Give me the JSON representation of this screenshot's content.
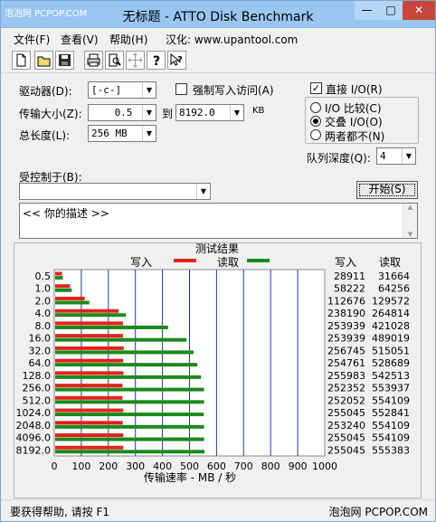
{
  "titlebar": {
    "watermark": "泡泡网 PCPOP.COM",
    "title": "无标题 - ATTO Disk Benchmark",
    "min": "—",
    "max": "□",
    "close": "✕"
  },
  "menu": {
    "file": "文件(F)",
    "view": "查看(V)",
    "help": "帮助(H)",
    "localized": "汉化: www.upantool.com"
  },
  "toolbar": {
    "buttons": [
      {
        "name": "new-icon",
        "glyph": "🗋"
      },
      {
        "name": "open-icon",
        "glyph": "📂"
      },
      {
        "name": "save-icon",
        "glyph": "💾"
      },
      {
        "name": "print-icon",
        "glyph": "🖶"
      },
      {
        "name": "print-preview-icon",
        "glyph": "🔍"
      },
      {
        "name": "move-icon",
        "glyph": "✥"
      },
      {
        "name": "about-icon",
        "glyph": "?"
      },
      {
        "name": "context-help-icon",
        "glyph": "?"
      }
    ]
  },
  "form": {
    "drive_label": "驱动器(D):",
    "drive_value": "[-c-]",
    "force_write_label": "强制写入访问(A)",
    "transfer_label": "传输大小(Z):",
    "transfer_from": "0.5",
    "to_label": "到",
    "transfer_to": "8192.0",
    "kb_label": "KB",
    "total_length_label": "总长度(L):",
    "total_length_value": "256 MB",
    "direct_io_label": "直接 I/O(R)",
    "direct_io_checked": true,
    "io_compare_label": "I/O 比较(C)",
    "overlapped_io_label": "交叠 I/O(O)",
    "neither_label": "两者都不(N)",
    "selected_mode": "overlapped",
    "queue_depth_label": "队列深度(Q):",
    "queue_depth_value": "4",
    "controlled_by_label": "受控制于(B):",
    "controlled_by_value": "",
    "start_button": "开始(S)",
    "description": "<<  你的描述  >>"
  },
  "results": {
    "title": "测试结果",
    "legend_write": "写入",
    "legend_read": "读取",
    "col_write": "写入",
    "col_read": "读取",
    "write_color": "#e3241b",
    "read_color": "#1b8a1b"
  },
  "chart_data": {
    "type": "bar",
    "orientation": "horizontal",
    "title": "测试结果",
    "xlabel": "传输速率 - MB / 秒",
    "ylabel": "",
    "xlim": [
      0,
      1000
    ],
    "xticks": [
      0,
      100,
      200,
      300,
      400,
      500,
      600,
      700,
      800,
      900,
      1000
    ],
    "categories": [
      "0.5",
      "1.0",
      "2.0",
      "4.0",
      "8.0",
      "16.0",
      "32.0",
      "64.0",
      "128.0",
      "256.0",
      "512.0",
      "1024.0",
      "2048.0",
      "4096.0",
      "8192.0"
    ],
    "series": [
      {
        "name": "写入",
        "values": [
          28.9,
          58.2,
          112.7,
          238.2,
          253.9,
          253.9,
          256.7,
          254.8,
          256.0,
          252.4,
          252.1,
          255.0,
          253.2,
          255.0,
          255.0
        ]
      },
      {
        "name": "读取",
        "values": [
          31.7,
          64.3,
          129.6,
          264.8,
          421.0,
          489.0,
          515.1,
          528.7,
          542.5,
          553.9,
          554.1,
          552.8,
          554.1,
          554.1,
          555.4
        ]
      }
    ],
    "table": {
      "write": [
        "28911",
        "58222",
        "112676",
        "238190",
        "253939",
        "253939",
        "256745",
        "254761",
        "255983",
        "252352",
        "252052",
        "255045",
        "253240",
        "255045",
        "255045"
      ],
      "read": [
        "31664",
        "64256",
        "129572",
        "264814",
        "421028",
        "489019",
        "515051",
        "528689",
        "542513",
        "553937",
        "554109",
        "552841",
        "554109",
        "554109",
        "555383"
      ]
    },
    "grid": true
  },
  "status": {
    "help_text": "要获得帮助, 请按 F1",
    "watermark": "泡泡网 PCPOP.COM"
  }
}
